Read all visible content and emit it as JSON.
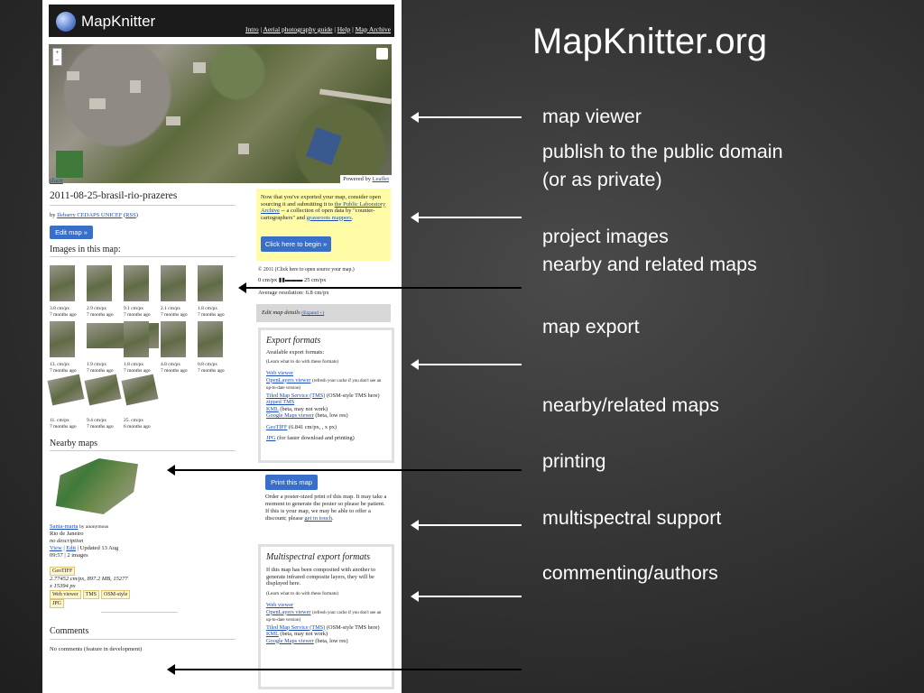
{
  "slide": {
    "title": "MapKnitter.org",
    "annotations": [
      "map viewer",
      "publish to the public domain",
      "(or as private)",
      "project images",
      "nearby and related maps",
      "map export",
      "nearby/related maps",
      "printing",
      "multispectral support",
      "commenting/authors"
    ]
  },
  "site": {
    "logo": "MapKnitter",
    "nav": [
      "Intro",
      "Aerial photography guide",
      "Help",
      "Map Archive"
    ],
    "viewer": {
      "share": "share",
      "powered_by": "Powered by",
      "powered_link": "Leaflet"
    },
    "map_title": "2011-08-25-brasil-rio-prazeres",
    "byline_prefix": "by",
    "byline_author": "Ilebarry CEDAPS UNICEF",
    "byline_rss": "RSS",
    "edit_map": "Edit map »",
    "images_heading": "Images in this map:",
    "images": [
      {
        "res": "3.8 cm/px",
        "age": "7 months ago"
      },
      {
        "res": "2.9 cm/px",
        "age": "7 months ago"
      },
      {
        "res": "9.1 cm/px",
        "age": "7 months ago"
      },
      {
        "res": "2.1 cm/px",
        "age": "7 months ago"
      },
      {
        "res": "1.8 cm/px",
        "age": "7 months ago"
      },
      {
        "res": "13. cm/px",
        "age": "7 months ago"
      },
      {
        "res": "1.9 cm/px",
        "age": "7 months ago"
      },
      {
        "res": "1.8 cm/px",
        "age": "7 months ago"
      },
      {
        "res": "4.8 cm/px",
        "age": "7 months ago"
      },
      {
        "res": "0.8 cm/px",
        "age": "7 months ago"
      },
      {
        "res": "11. cm/px",
        "age": "7 months ago"
      },
      {
        "res": "9.4 cm/px",
        "age": "7 months ago"
      },
      {
        "res": "25. cm/px",
        "age": "6 months ago"
      }
    ],
    "nearby_heading": "Nearby maps",
    "nearby": {
      "name": "Santa-marta",
      "by": "by anonymous",
      "place": "Rio de Janeiro",
      "desc": "no description",
      "view": "View",
      "edit": "Edit",
      "updated": "Updated 13 Aug",
      "updated2": "09:57 | 2 images",
      "geotiff": "GeoTIFF",
      "stats1": "2.77452 cm/px, 897.2 MB, 15277",
      "stats2": "x 15394 px",
      "tags": [
        "Web viewer",
        "TMS",
        "OSM-style",
        "JPG"
      ]
    },
    "comments_heading": "Comments",
    "comments_text": "No comments (feature in development)",
    "publish_box": {
      "text": "Now that you've exported your map, consider open sourcing it and submitting it to",
      "link": "the Public Laboratory Archive",
      "text2": "-- a collection of open data by \"counter-cartographers\" and",
      "link2": "grassroots mappers",
      "button": "Click here to begin »"
    },
    "license_text": "© 2011 (Click here to open source your map.)",
    "scale_text": "0 cm/px ▮▮▬▬▬ 25 cm/px",
    "avg_res": "Average resolution: 6.8 cm/px",
    "edit_details": "Edit map details",
    "expand": "(Expand +)",
    "export": {
      "title": "Export formats",
      "avail": "Available export formats:",
      "learn": "(Learn what to do with these formats)",
      "web_viewer": "Web viewer",
      "openlayers": "OpenLayers viewer",
      "openlayers_note": "(refresh your cache if you don't see an up-to-date version)",
      "tms": "Tiled Map Service (TMS)",
      "tms_osm": "(OSM-style TMS here)",
      "zipped": "zipped TMS",
      "kml": "KML",
      "kml_note": "(beta, may not work)",
      "gmaps": "Google Maps viewer",
      "gmaps_note": "(beta, low res)",
      "geotiff": "GeoTIFF",
      "geotiff_note": "(6.841 cm/px, , x px)",
      "jpg": "JPG",
      "jpg_note": "(for faster download and printing)"
    },
    "print": {
      "button": "Print this map",
      "text": "Order a poster-sized print of this map. It may take a moment to generate the poster so please be patient. If this is your map, we may be able to offer a discount; please",
      "link": "get in touch"
    },
    "multispectral": {
      "title": "Multispectral export formats",
      "text": "If this map has been composited with another to generate infrared composite layers, they will be displayed here.",
      "learn": "(Learn what to do with these formats)",
      "web_viewer": "Web viewer",
      "openlayers": "OpenLayers viewer",
      "openlayers_note": "(refresh your cache if you don't see an up-to-date version)",
      "tms": "Tiled Map Service (TMS)",
      "tms_osm": "(OSM-style TMS here)",
      "kml": "KML",
      "kml_note": "(beta, may not work)",
      "gmaps": "Google Maps viewer",
      "gmaps_note": "(beta, low res)"
    }
  }
}
